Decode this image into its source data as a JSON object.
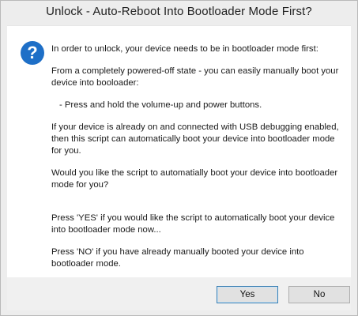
{
  "window": {
    "title": "Unlock - Auto-Reboot Into Bootloader Mode First?"
  },
  "icon": {
    "name": "question-icon",
    "glyph": "?",
    "color": "#1e6fc7"
  },
  "message": {
    "p1": "In order to unlock, your device needs to be in bootloader mode first:",
    "p2": "From a completely powered-off state - you can easily manually boot your device into booloader:",
    "p3": "- Press and hold the volume-up and power buttons.",
    "p4": "If your device is already on and connected with USB debugging enabled, then this script can automatically boot your device into bootloader mode for you.",
    "p5": "Would you like the script to automatially boot your device into bootloader mode for you?",
    "p6": "Press 'YES' if you would like the script to automatically boot your device into bootloader mode now...",
    "p7": "Press 'NO' if you have already manually booted your device into bootloader mode."
  },
  "buttons": {
    "yes_label": "Yes",
    "no_label": "No"
  }
}
